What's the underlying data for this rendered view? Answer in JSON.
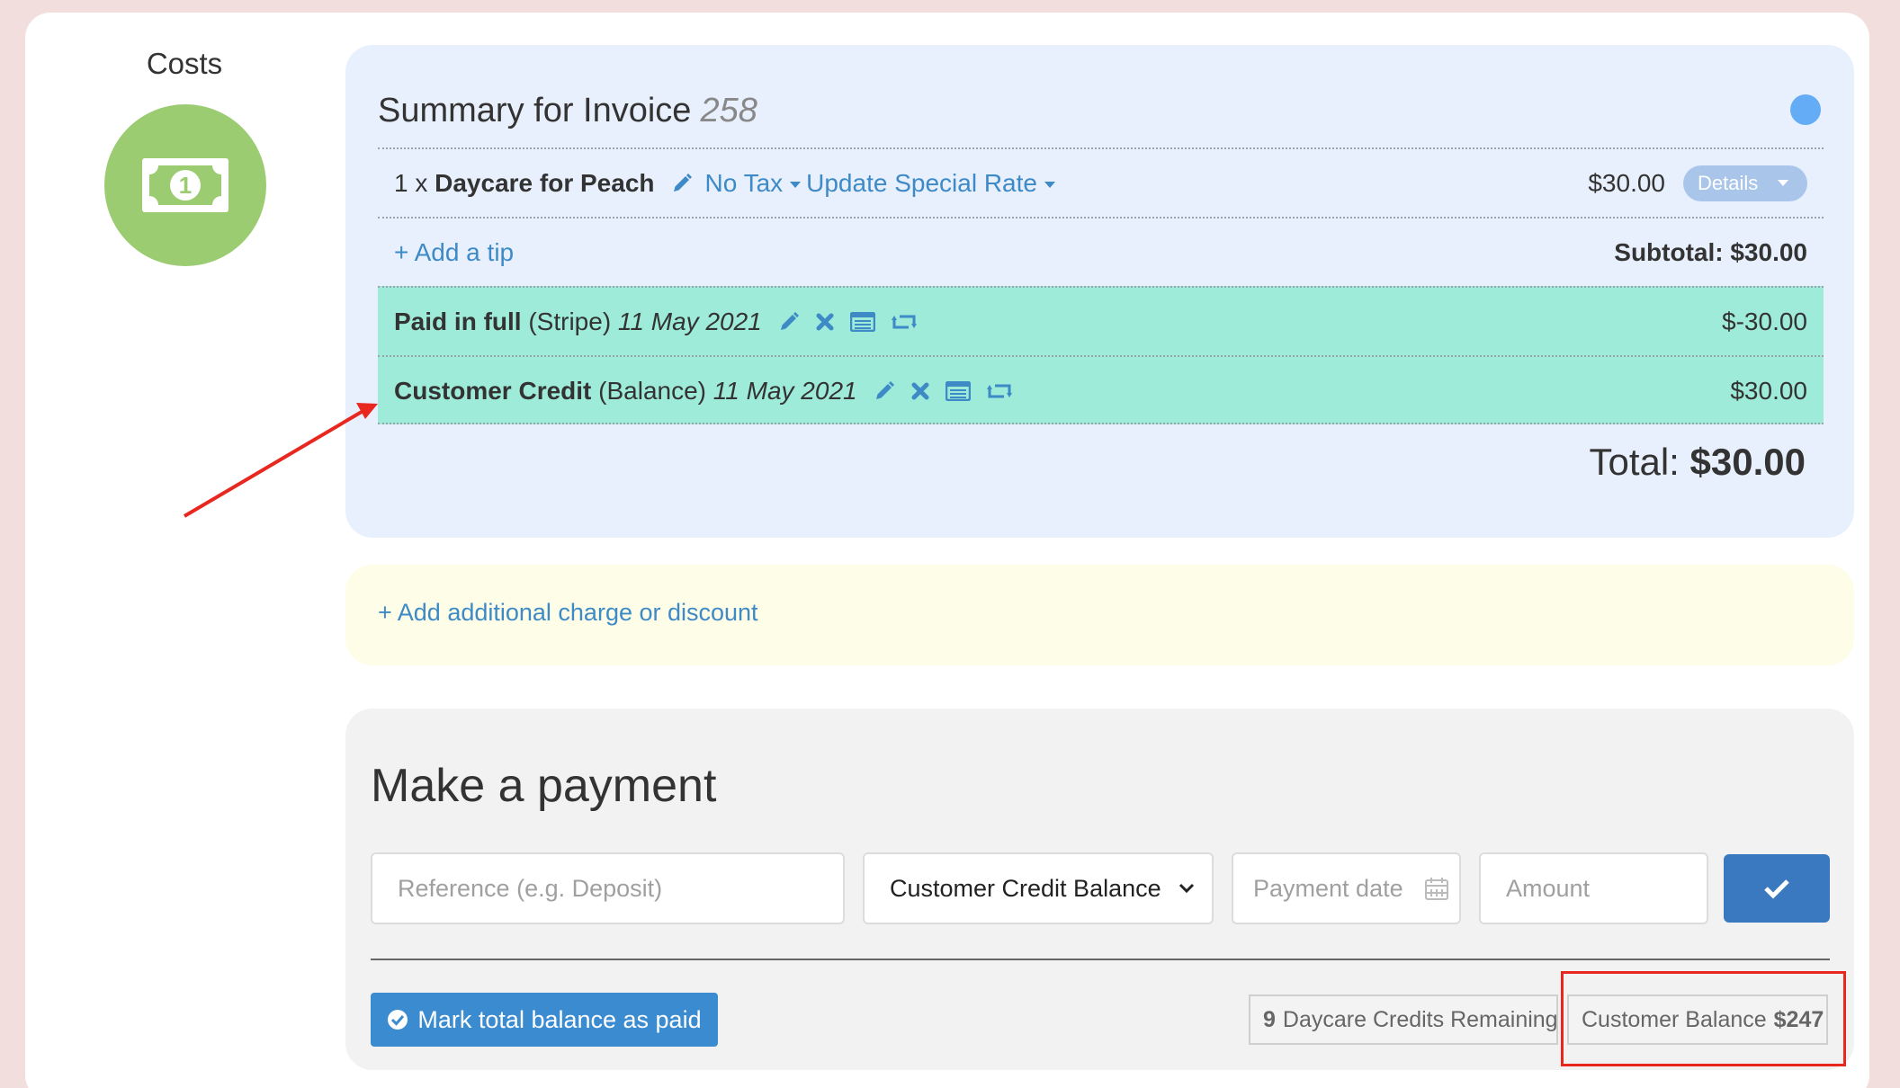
{
  "costs": {
    "title": "Costs",
    "icon": "money-bill-icon"
  },
  "summary": {
    "title": "Summary for Invoice",
    "invoice_number": "258",
    "line_item": {
      "quantity": "1 x",
      "name": "Daycare for Peach",
      "tax_label": "No Tax",
      "special_rate_label": "Update Special Rate",
      "price": "$30.00",
      "details_label": "Details"
    },
    "add_tip_label": "+ Add a tip",
    "subtotal": "Subtotal: $30.00",
    "payments": [
      {
        "label": "Paid in full",
        "method": "(Stripe)",
        "date": "11 May 2021",
        "amount": "$-30.00"
      },
      {
        "label": "Customer Credit",
        "method": "(Balance)",
        "date": "11 May 2021",
        "amount": "$30.00"
      }
    ],
    "total_label": "Total:",
    "total_value": "$30.00"
  },
  "additional": {
    "add_label": "+ Add additional charge or discount"
  },
  "payment": {
    "title": "Make a payment",
    "reference_placeholder": "Reference (e.g. Deposit)",
    "method_value": "Customer Credit Balance",
    "date_placeholder": "Payment date",
    "amount_placeholder": "Amount",
    "mark_paid_label": "Mark total balance as paid",
    "credits_count": "9",
    "credits_label": "Daycare Credits Remaining",
    "balance_label": "Customer Balance",
    "balance_value": "$247"
  },
  "colors": {
    "summary_bg": "#e8f0fd",
    "payment_row_bg": "#9debd8",
    "link": "#3d8ac7",
    "primary_button": "#3a79bf",
    "annotation": "#e8271f"
  }
}
